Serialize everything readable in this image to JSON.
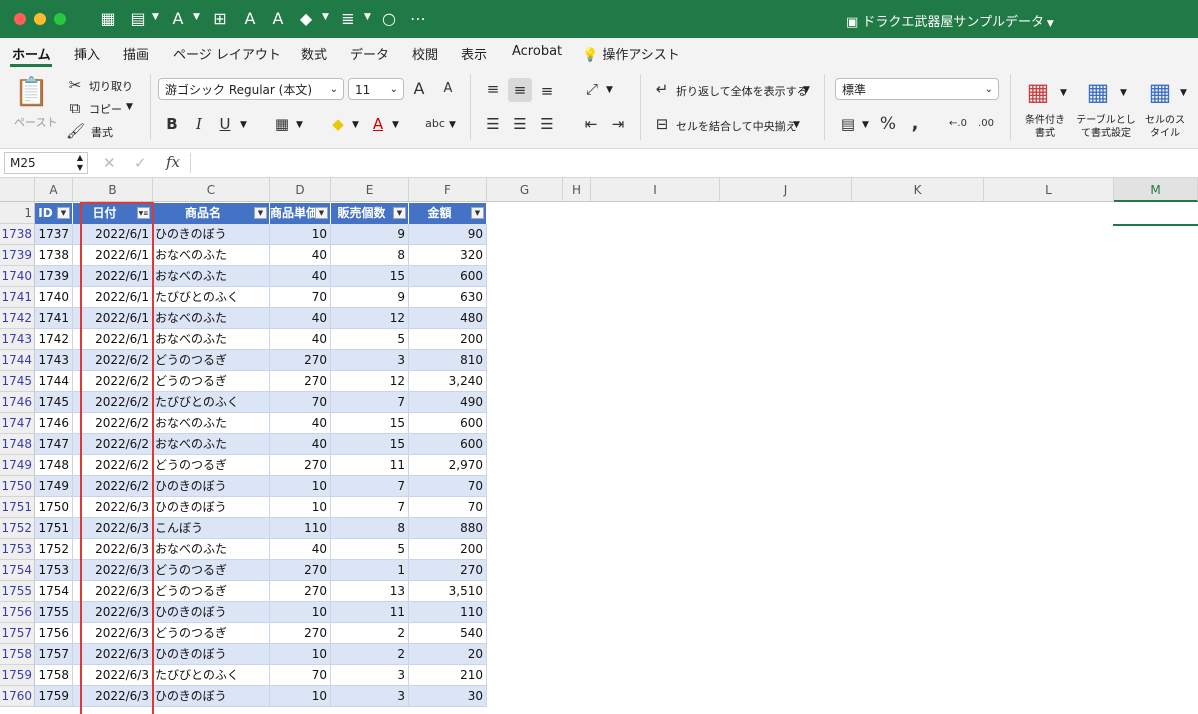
{
  "window": {
    "title": "ドラクエ武器屋サンプルデータ"
  },
  "colors": {
    "titlebar": "#1f7a45",
    "table_header": "#4472c4",
    "band_a": "#dbe5f5",
    "band_b": "#ffffff",
    "filter_highlight": "#d93a3a"
  },
  "ribbon_tabs": [
    "ホーム",
    "挿入",
    "描画",
    "ページ レイアウト",
    "数式",
    "データ",
    "校閲",
    "表示",
    "Acrobat",
    "操作アシスト"
  ],
  "ribbon": {
    "paste": "ペースト",
    "cut": "切り取り",
    "copy": "コピー",
    "format_painter": "書式",
    "font_name": "游ゴシック Regular (本文)",
    "font_size": "11",
    "bold": "B",
    "italic": "I",
    "underline": "U",
    "wrap_text": "折り返して全体を表示する",
    "merge_center": "セルを結合して中央揃え",
    "number_format": "標準",
    "conditional_format": "条件付き書式",
    "format_as_table": "テーブルとして書式設定",
    "cell_styles": "セルのスタイル"
  },
  "formula_bar": {
    "name_box": "M25",
    "fx": "fx",
    "value": ""
  },
  "columns": [
    "A",
    "B",
    "C",
    "D",
    "E",
    "F",
    "G",
    "H",
    "I",
    "J",
    "K",
    "L",
    "M"
  ],
  "header_row_number": "1",
  "table_headers": [
    "ID",
    "日付",
    "商品名",
    "商品単価",
    "販売個数",
    "金額"
  ],
  "rows": [
    {
      "r": "1738",
      "id": "1737",
      "date": "2022/6/1",
      "item": "ひのきのぼう",
      "price": "10",
      "qty": "9",
      "amount": "90"
    },
    {
      "r": "1739",
      "id": "1738",
      "date": "2022/6/1",
      "item": "おなべのふた",
      "price": "40",
      "qty": "8",
      "amount": "320"
    },
    {
      "r": "1740",
      "id": "1739",
      "date": "2022/6/1",
      "item": "おなべのふた",
      "price": "40",
      "qty": "15",
      "amount": "600"
    },
    {
      "r": "1741",
      "id": "1740",
      "date": "2022/6/1",
      "item": "たびびとのふく",
      "price": "70",
      "qty": "9",
      "amount": "630"
    },
    {
      "r": "1742",
      "id": "1741",
      "date": "2022/6/1",
      "item": "おなべのふた",
      "price": "40",
      "qty": "12",
      "amount": "480"
    },
    {
      "r": "1743",
      "id": "1742",
      "date": "2022/6/1",
      "item": "おなべのふた",
      "price": "40",
      "qty": "5",
      "amount": "200"
    },
    {
      "r": "1744",
      "id": "1743",
      "date": "2022/6/2",
      "item": "どうのつるぎ",
      "price": "270",
      "qty": "3",
      "amount": "810"
    },
    {
      "r": "1745",
      "id": "1744",
      "date": "2022/6/2",
      "item": "どうのつるぎ",
      "price": "270",
      "qty": "12",
      "amount": "3,240"
    },
    {
      "r": "1746",
      "id": "1745",
      "date": "2022/6/2",
      "item": "たびびとのふく",
      "price": "70",
      "qty": "7",
      "amount": "490"
    },
    {
      "r": "1747",
      "id": "1746",
      "date": "2022/6/2",
      "item": "おなべのふた",
      "price": "40",
      "qty": "15",
      "amount": "600"
    },
    {
      "r": "1748",
      "id": "1747",
      "date": "2022/6/2",
      "item": "おなべのふた",
      "price": "40",
      "qty": "15",
      "amount": "600"
    },
    {
      "r": "1749",
      "id": "1748",
      "date": "2022/6/2",
      "item": "どうのつるぎ",
      "price": "270",
      "qty": "11",
      "amount": "2,970"
    },
    {
      "r": "1750",
      "id": "1749",
      "date": "2022/6/2",
      "item": "ひのきのぼう",
      "price": "10",
      "qty": "7",
      "amount": "70"
    },
    {
      "r": "1751",
      "id": "1750",
      "date": "2022/6/3",
      "item": "ひのきのぼう",
      "price": "10",
      "qty": "7",
      "amount": "70"
    },
    {
      "r": "1752",
      "id": "1751",
      "date": "2022/6/3",
      "item": "こんぼう",
      "price": "110",
      "qty": "8",
      "amount": "880"
    },
    {
      "r": "1753",
      "id": "1752",
      "date": "2022/6/3",
      "item": "おなべのふた",
      "price": "40",
      "qty": "5",
      "amount": "200"
    },
    {
      "r": "1754",
      "id": "1753",
      "date": "2022/6/3",
      "item": "どうのつるぎ",
      "price": "270",
      "qty": "1",
      "amount": "270"
    },
    {
      "r": "1755",
      "id": "1754",
      "date": "2022/6/3",
      "item": "どうのつるぎ",
      "price": "270",
      "qty": "13",
      "amount": "3,510"
    },
    {
      "r": "1756",
      "id": "1755",
      "date": "2022/6/3",
      "item": "ひのきのぼう",
      "price": "10",
      "qty": "11",
      "amount": "110"
    },
    {
      "r": "1757",
      "id": "1756",
      "date": "2022/6/3",
      "item": "どうのつるぎ",
      "price": "270",
      "qty": "2",
      "amount": "540"
    },
    {
      "r": "1758",
      "id": "1757",
      "date": "2022/6/3",
      "item": "ひのきのぼう",
      "price": "10",
      "qty": "2",
      "amount": "20"
    },
    {
      "r": "1759",
      "id": "1758",
      "date": "2022/6/3",
      "item": "たびびとのふく",
      "price": "70",
      "qty": "3",
      "amount": "210"
    },
    {
      "r": "1760",
      "id": "1759",
      "date": "2022/6/3",
      "item": "ひのきのぼう",
      "price": "10",
      "qty": "3",
      "amount": "30"
    }
  ]
}
